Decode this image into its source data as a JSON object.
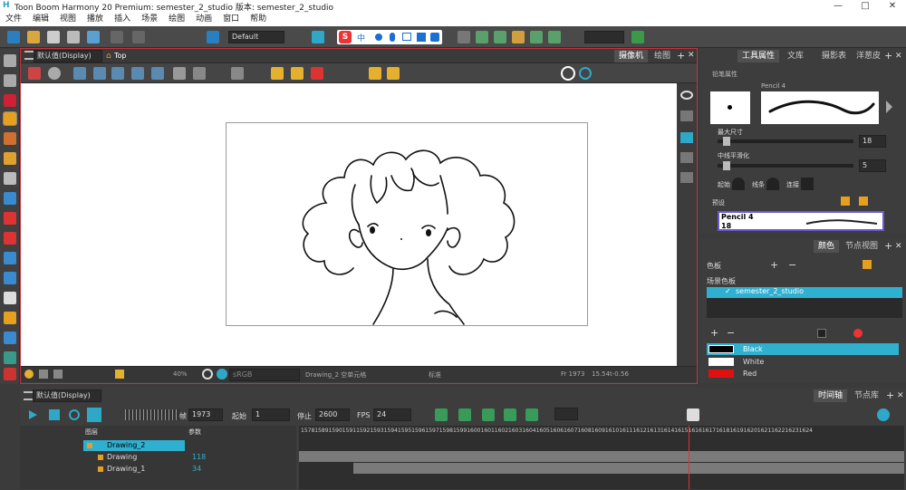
{
  "title": "Toon Boom Harmony 20 Premium: semester_2_studio 版本: semester_2_studio",
  "menu": [
    "文件",
    "编辑",
    "视图",
    "播放",
    "插入",
    "场景",
    "绘图",
    "动画",
    "窗口",
    "帮助"
  ],
  "toolbar": {
    "preset": "Default"
  },
  "ime": {
    "s": "S",
    "zh": "中"
  },
  "camera": {
    "view": "默认值(Display)",
    "top": "Top",
    "tab_camera": "摄像机",
    "tab_drawing": "绘图"
  },
  "camstatus": {
    "zoom": "40%",
    "colorspace": "sRGB",
    "layer": "Drawing_2 空单元格",
    "mode": "标准",
    "frame": "Fr 1973",
    "coords": "15.54t-0.56"
  },
  "props": {
    "tabs": [
      "工具属性",
      "文库",
      "摄影表",
      "洋葱皮"
    ],
    "section": "铅笔属性",
    "brush": "Pencil 4",
    "max_size_label": "最大尺寸",
    "max_size": "18",
    "smoothing_label": "中线平滑化",
    "smoothing": "5",
    "start_label": "起始",
    "join_label": "线条",
    "end_label": "连接",
    "preset_label": "预设",
    "preset_name": "Pencil 4",
    "preset_size": "18"
  },
  "colors": {
    "tabs": [
      "颜色",
      "节点视图"
    ],
    "palette_label": "色板",
    "scene_palette": "场景色板",
    "studio": "semester_2_studio",
    "swatches": [
      {
        "name": "Black",
        "color": "#000000"
      },
      {
        "name": "White",
        "color": "#ffffff"
      },
      {
        "name": "Red",
        "color": "#e01010"
      }
    ]
  },
  "timeline": {
    "view": "默认值(Display)",
    "tabs": [
      "时间轴",
      "节点库"
    ],
    "frame": "1973",
    "start_label": "起始",
    "start": "1",
    "stop_label": "停止",
    "stop": "2600",
    "fps_label": "FPS",
    "fps": "24",
    "frame_label": "帧",
    "layers_label": "图层",
    "params_label": "参数",
    "layers": [
      {
        "name": "Drawing_2",
        "value": ""
      },
      {
        "name": "Drawing",
        "value": "118"
      },
      {
        "name": "Drawing_1",
        "value": "34"
      }
    ],
    "ruler": "1578158915901591159215931594159515961597159815991600160116021603160416051606160716081609161016111612161316141615161616171618161916201621162216231624"
  }
}
